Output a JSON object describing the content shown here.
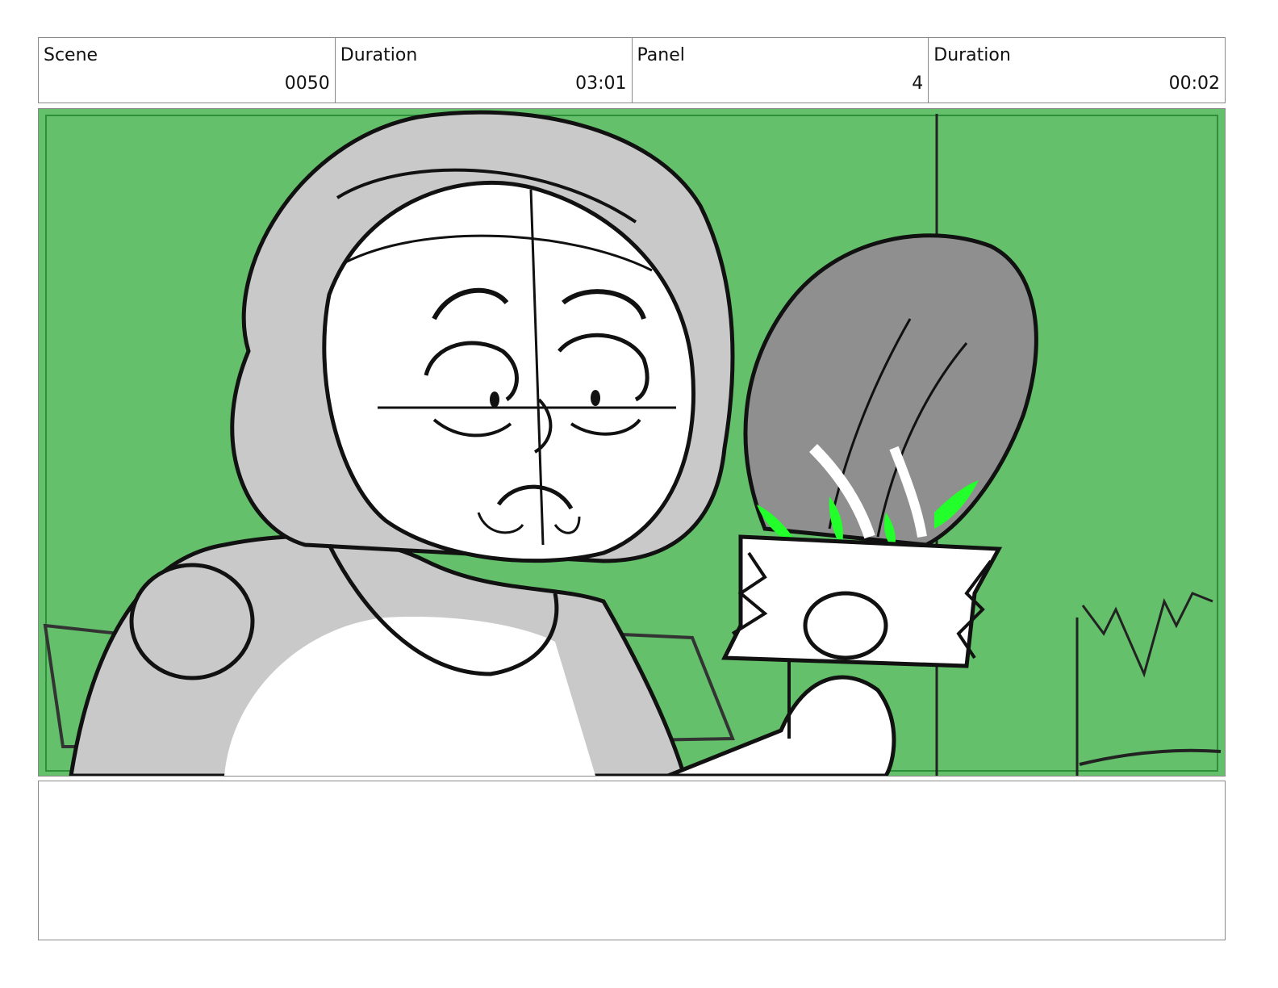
{
  "header": {
    "scene_label": "Scene",
    "scene_value": "0050",
    "scene_duration_label": "Duration",
    "scene_duration_value": "03:01",
    "panel_label": "Panel",
    "panel_value": "4",
    "panel_duration_label": "Duration",
    "panel_duration_value": "00:02"
  },
  "panel_image": {
    "background_color": "#64c06a",
    "frame_color": "#2e8f3a",
    "highlight_color": "#22ff2a"
  },
  "notes": {
    "text": ""
  }
}
